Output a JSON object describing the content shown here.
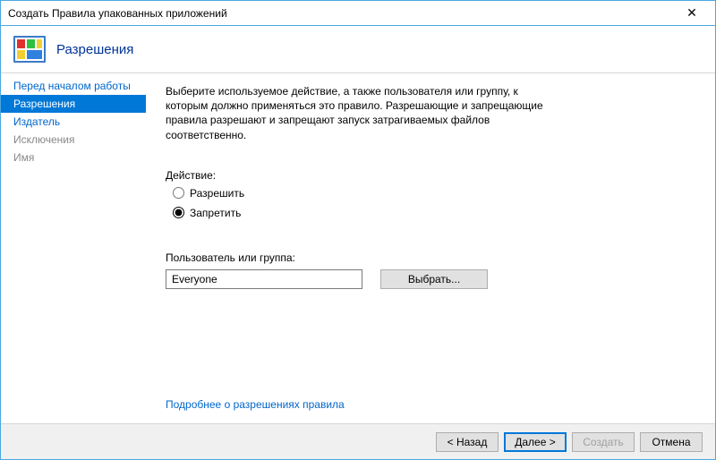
{
  "window": {
    "title": "Создать Правила упакованных приложений"
  },
  "header": {
    "title": "Разрешения"
  },
  "sidebar": {
    "items": [
      {
        "label": "Перед началом работы",
        "state": "link"
      },
      {
        "label": "Разрешения",
        "state": "selected"
      },
      {
        "label": "Издатель",
        "state": "link"
      },
      {
        "label": "Исключения",
        "state": "dim"
      },
      {
        "label": "Имя",
        "state": "dim"
      }
    ]
  },
  "main": {
    "description": "Выберите используемое действие, а также пользователя или группу, к которым должно применяться это правило. Разрешающие и запрещающие правила разрешают и запрещают запуск затрагиваемых файлов соответственно.",
    "action_label": "Действие:",
    "radio_allow": "Разрешить",
    "radio_deny": "Запретить",
    "selected_action": "deny",
    "user_label": "Пользователь или группа:",
    "user_value": "Everyone",
    "select_button": "Выбрать...",
    "more_link": "Подробнее о разрешениях правила"
  },
  "footer": {
    "back": "< Назад",
    "next": "Далее >",
    "create": "Создать",
    "cancel": "Отмена"
  }
}
